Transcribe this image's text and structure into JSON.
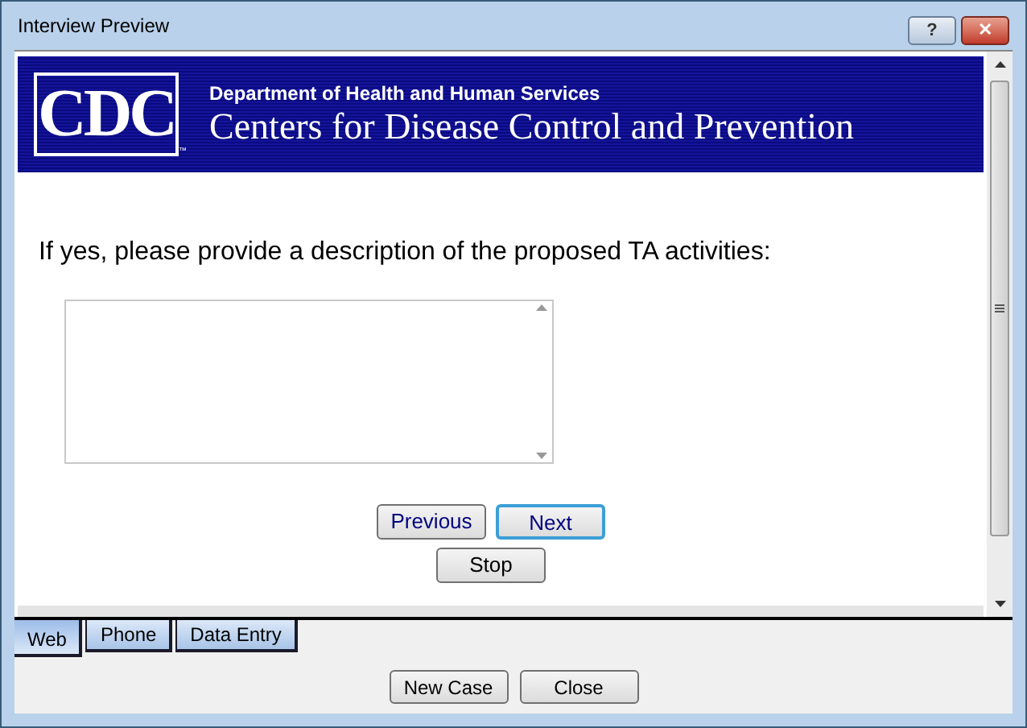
{
  "window": {
    "title": "Interview Preview",
    "buttons": [
      "?",
      "✕"
    ]
  },
  "banner": {
    "logo": "CDC",
    "department": "Department of Health and Human Services",
    "agency": "Centers for Disease Control and Prevention",
    "mark": "™"
  },
  "question": {
    "text": "If yes, please provide a description of the proposed TA activities:"
  },
  "nav_buttons": [
    {
      "label": "Previous",
      "focused": false
    },
    {
      "label": "Next",
      "focused": true
    }
  ],
  "stop_button": "Stop",
  "tabs": [
    {
      "label": "Web",
      "selected": true
    },
    {
      "label": "Phone",
      "selected": false
    },
    {
      "label": "Data Entry",
      "selected": false
    }
  ],
  "buttons": [
    "New Case",
    "Close"
  ]
}
